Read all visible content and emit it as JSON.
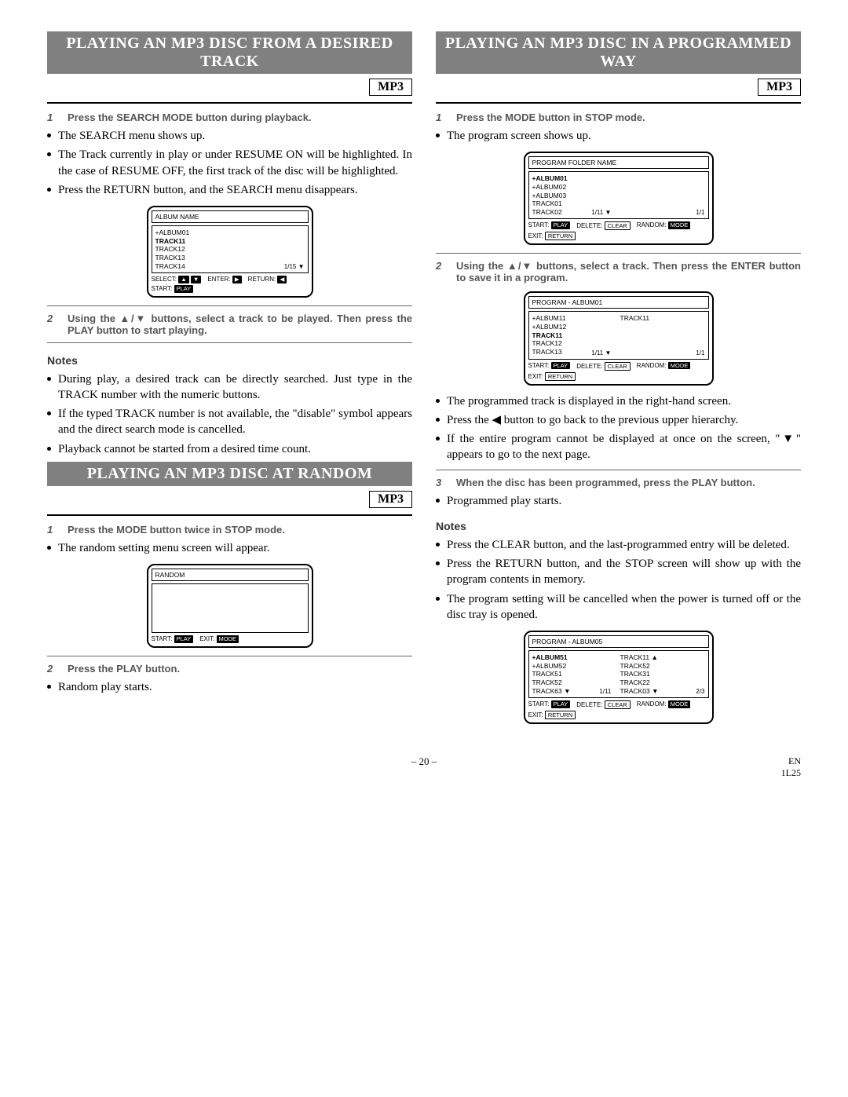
{
  "left": {
    "section1": {
      "title": "PLAYING AN MP3 DISC FROM A DESIRED TRACK",
      "badge": "MP3",
      "step1": {
        "num": "1",
        "text": "Press the SEARCH MODE button during playback."
      },
      "b1": "The SEARCH menu shows up.",
      "b2": "The Track currently in play or under RESUME ON will be highlighted. In the case of RESUME OFF, the first track of the disc will be highlighted.",
      "b3": "Press the RETURN button, and the SEARCH menu disappears.",
      "osd1": {
        "title": "ALBUM NAME",
        "items": [
          "+ALBUM01",
          "TRACK11",
          "TRACK12",
          "TRACK13",
          "TRACK14"
        ],
        "selIndex": 1,
        "pager": "1/15 ▼",
        "foot": {
          "select": "SELECT:",
          "selBadge1": "▲",
          "selBadge2": "▼",
          "enter": "ENTER:",
          "enterBadge": "▶",
          "return": "RETURN:",
          "returnBadge": "◀",
          "start": "START:",
          "startBadge": "PLAY"
        }
      },
      "step2": {
        "num": "2",
        "text": "Using the ▲/▼ buttons, select a track to be played. Then press the PLAY button to start playing."
      },
      "notesH": "Notes",
      "n1": "During play, a desired track can be directly searched. Just type in the TRACK number with the numeric buttons.",
      "n2": "If the typed TRACK number is not available, the \"disable\" symbol appears and the direct search mode is cancelled.",
      "n3": "Playback cannot be started from a desired time count."
    },
    "section2": {
      "title": "PLAYING AN MP3 DISC AT RANDOM",
      "badge": "MP3",
      "step1": {
        "num": "1",
        "text": "Press the MODE button twice in STOP mode."
      },
      "b1": "The random setting menu screen will appear.",
      "osd2": {
        "title": "RANDOM",
        "foot": {
          "start": "START:",
          "startBadge": "PLAY",
          "exit": "EXIT:",
          "exitBadge": "MODE"
        }
      },
      "step2": {
        "num": "2",
        "text": "Press the PLAY button."
      },
      "b2": "Random play starts."
    }
  },
  "right": {
    "section1": {
      "title": "PLAYING AN MP3 DISC IN A PROGRAMMED WAY",
      "badge": "MP3",
      "step1": {
        "num": "1",
        "text": "Press the MODE button in STOP mode."
      },
      "b1": "The program screen shows up.",
      "osd1": {
        "title": "PROGRAM FOLDER NAME",
        "items": [
          "+ALBUM01",
          "+ALBUM02",
          "+ALBUM03",
          "TRACK01",
          "TRACK02"
        ],
        "selIndex": 0,
        "pagerL": "1/11 ▼",
        "pagerR": "1/1",
        "foot": {
          "start": "START:",
          "startBadge": "PLAY",
          "delete": "DELETE:",
          "deleteBadge": "CLEAR",
          "random": "RANDOM:",
          "randomBadge": "MODE",
          "exit": "EXIT:",
          "exitBadge": "RETURN"
        }
      },
      "step2": {
        "num": "2",
        "text": "Using the ▲/▼ buttons, select a track. Then press the ENTER button to save it in a program."
      },
      "osd2": {
        "title": "PROGRAM - ALBUM01",
        "leftItems": [
          "+ALBUM11",
          "+ALBUM12",
          "TRACK11",
          "TRACK12",
          "TRACK13"
        ],
        "selIndex": 2,
        "rightItems": [
          "TRACK11"
        ],
        "pagerL": "1/11 ▼",
        "pagerR": "1/1",
        "foot": {
          "start": "START:",
          "startBadge": "PLAY",
          "delete": "DELETE:",
          "deleteBadge": "CLEAR",
          "random": "RANDOM:",
          "randomBadge": "MODE",
          "exit": "EXIT:",
          "exitBadge": "RETURN"
        }
      },
      "b2": "The programmed track is displayed in the right-hand screen.",
      "b3": "Press the ◀ button to go back to the previous upper hierarchy.",
      "b4": "If the entire program cannot be displayed at once on the screen, \"▼\" appears to go to the next page.",
      "step3": {
        "num": "3",
        "text": "When the disc has been programmed, press the PLAY button."
      },
      "b5": "Programmed play starts.",
      "notesH": "Notes",
      "n1": "Press the CLEAR button, and the last-programmed entry will be deleted.",
      "n2": "Press the RETURN button, and the STOP screen will show up with the program contents in memory.",
      "n3": "The program setting will be cancelled when the power is turned off or the disc tray is opened.",
      "osd3": {
        "title": "PROGRAM - ALBUM05",
        "leftItems": [
          "+ALBUM51",
          "+ALBUM52",
          "TRACK51",
          "TRACK52",
          "TRACK63 ▼"
        ],
        "selIndex": 0,
        "rightItems": [
          "TRACK11 ▲",
          "TRACK52",
          "TRACK31",
          "TRACK22",
          "TRACK03 ▼"
        ],
        "pagerL": "1/11",
        "pagerR": "2/3",
        "foot": {
          "start": "START:",
          "startBadge": "PLAY",
          "delete": "DELETE:",
          "deleteBadge": "CLEAR",
          "random": "RANDOM:",
          "randomBadge": "MODE",
          "exit": "EXIT:",
          "exitBadge": "RETURN"
        }
      }
    }
  },
  "footer": {
    "page": "– 20 –",
    "lang": "EN",
    "code": "1L25"
  }
}
